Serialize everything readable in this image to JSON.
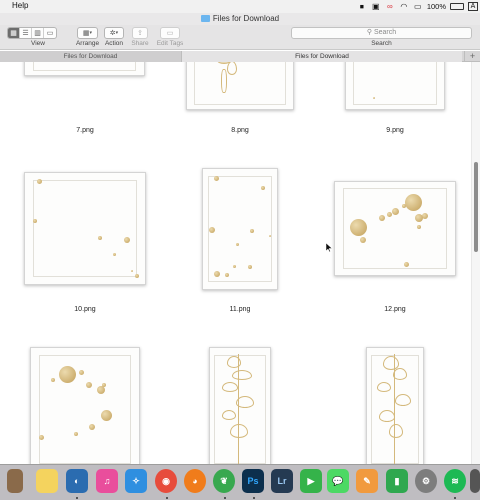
{
  "menubar": {
    "menu_help": "Help",
    "battery_percent": "100%",
    "input_source": "A",
    "tray_icons": [
      "stop-icon",
      "extension-icon",
      "creative-cloud-icon",
      "wifi-icon",
      "airplay-icon",
      "battery-icon"
    ]
  },
  "window": {
    "title": "Files for Download"
  },
  "toolbar": {
    "view_label": "View",
    "arrange_label": "Arrange",
    "action_label": "Action",
    "share_label": "Share",
    "edit_tags_label": "Edit Tags",
    "search_placeholder": "Search",
    "search_label": "Search"
  },
  "tabs": [
    {
      "label": "Files for Download"
    },
    {
      "label": "Files for Download"
    }
  ],
  "files": [
    {
      "name": "7.png"
    },
    {
      "name": "8.png"
    },
    {
      "name": "9.png"
    },
    {
      "name": "10.png"
    },
    {
      "name": "11.png"
    },
    {
      "name": "12.png"
    },
    {
      "name": ""
    },
    {
      "name": ""
    },
    {
      "name": ""
    }
  ],
  "dock_apps": [
    {
      "name": "notes",
      "color": "#f4d35e"
    },
    {
      "name": "quicktime",
      "color": "#2b6cb0"
    },
    {
      "name": "itunes",
      "color": "#e94e9c"
    },
    {
      "name": "safari",
      "color": "#2f8fe0"
    },
    {
      "name": "chrome",
      "color": "#e74c3c"
    },
    {
      "name": "firefox",
      "color": "#f07c1b"
    },
    {
      "name": "evernote",
      "color": "#38a84f"
    },
    {
      "name": "photoshop",
      "color": "#0c2f4d"
    },
    {
      "name": "lightroom",
      "color": "#253a52"
    },
    {
      "name": "facetime",
      "color": "#35b34a"
    },
    {
      "name": "messages",
      "color": "#4cd964"
    },
    {
      "name": "pages",
      "color": "#f19a3e"
    },
    {
      "name": "numbers",
      "color": "#2fa84f"
    },
    {
      "name": "system-preferences",
      "color": "#7d7d7d"
    },
    {
      "name": "spotify",
      "color": "#1db954"
    }
  ],
  "dock_labels": {
    "photoshop": "Ps",
    "lightroom": "Lr"
  }
}
